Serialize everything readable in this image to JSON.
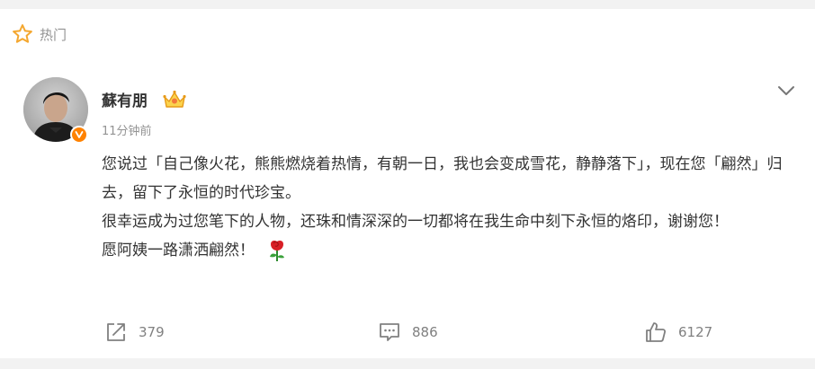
{
  "header": {
    "hot_label": "热门",
    "icon": "star-icon"
  },
  "post": {
    "author": {
      "name": "蘇有朋",
      "badge_icon": "crown-icon",
      "verified_icon": "verified-badge-icon",
      "verified_color": "#ff8200"
    },
    "time": "11分钟前",
    "paragraphs": [
      "您说过「自己像火花，熊熊燃烧着热情，有朝一日，我也会变成雪花，静静落下」，现在您「翩然」归去，留下了永恒的时代珍宝。",
      "很幸运成为过您笔下的人物，还珠和情深深的一切都将在我生命中刻下永恒的烙印，谢谢您！",
      "愿阿姨一路潇洒翩然！"
    ],
    "emoji": "rose"
  },
  "actions": {
    "forward": {
      "count": "379",
      "icon": "share-icon"
    },
    "comment": {
      "count": "886",
      "icon": "comment-icon"
    },
    "like": {
      "count": "6127",
      "icon": "thumbs-up-icon"
    }
  },
  "colors": {
    "accent": "#ff8200",
    "hot_star": "#f4a72f",
    "muted": "#939393"
  }
}
